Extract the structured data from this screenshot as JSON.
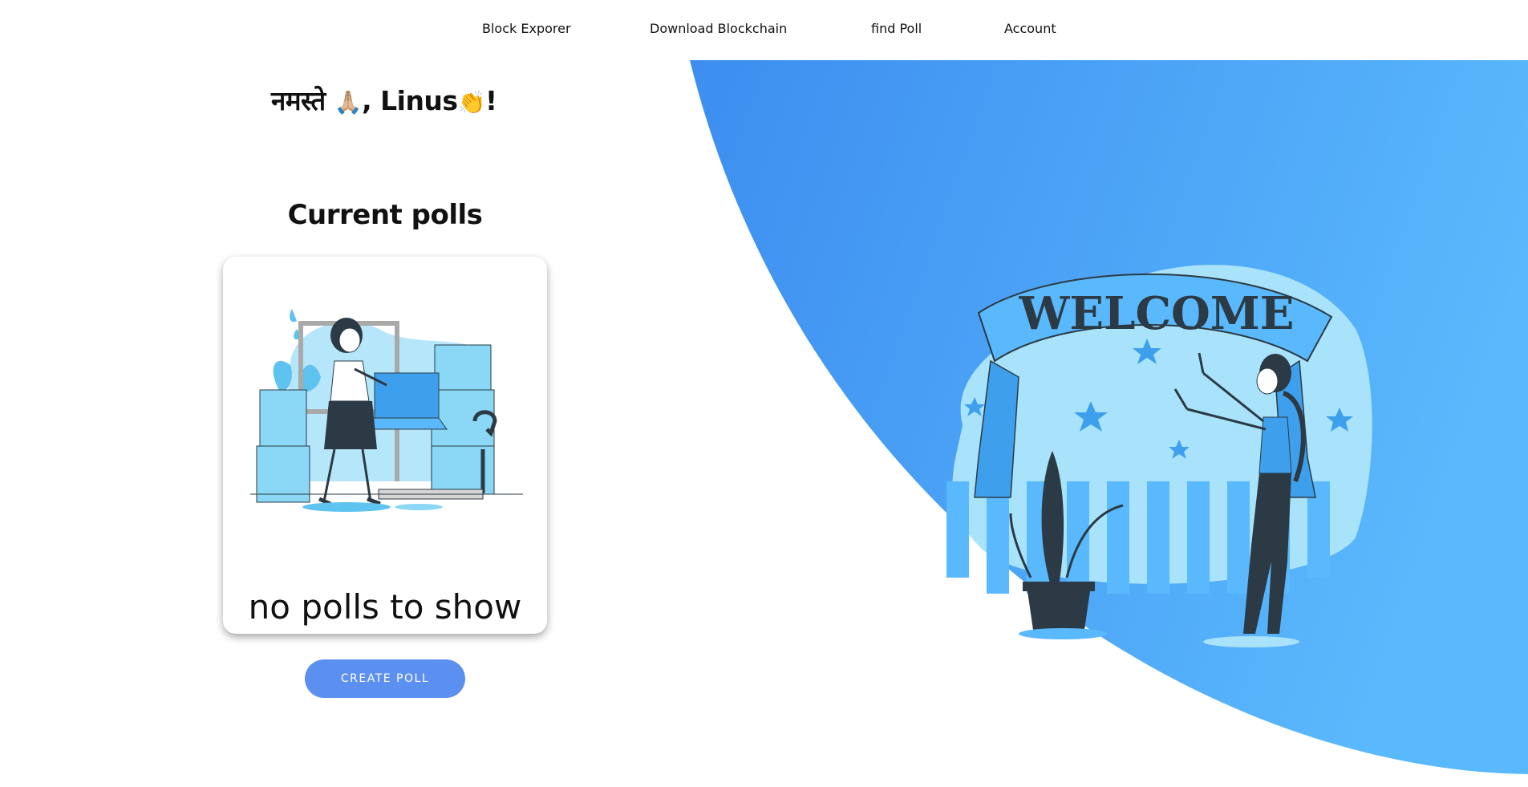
{
  "nav": {
    "items": [
      {
        "label": "Block Exporer"
      },
      {
        "label": "Download Blockchain"
      },
      {
        "label": "find Poll"
      },
      {
        "label": "Account"
      }
    ]
  },
  "greeting": {
    "text": "नमस्ते",
    "hands_emoji": "🙏🏼",
    "name_text": ", Linus",
    "wave_emoji": "👏",
    "exclaim": "!"
  },
  "polls": {
    "title": "Current polls",
    "empty_message": "no polls to show",
    "create_label": "CREATE POLL"
  },
  "hero": {
    "banner_text": "WELCOME"
  },
  "colors": {
    "accent": "#5b8ff0",
    "hero_blue_start": "#3d8ef0",
    "hero_blue_end": "#5ab8fc",
    "light_blue": "#a9e3fb"
  }
}
